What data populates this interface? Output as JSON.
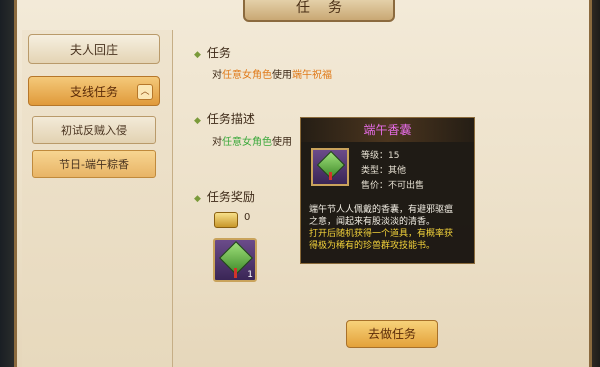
{
  "window": {
    "title": "任务"
  },
  "sidebar": {
    "tabs": [
      {
        "label": "夫人回庄"
      },
      {
        "label": "支线任务",
        "toggle": "︿"
      }
    ],
    "sub_items": [
      {
        "label": "初试反贼入侵"
      },
      {
        "label": "节日-端午粽香"
      }
    ]
  },
  "task": {
    "heading": "任务",
    "line": {
      "prefix": "对",
      "target": "任意女角色",
      "verb": "使用",
      "item": "端午祝福"
    }
  },
  "description": {
    "heading": "任务描述",
    "line": {
      "prefix": "对",
      "target": "任意女角色",
      "verb": "使用"
    }
  },
  "rewards": {
    "heading": "任务奖励",
    "coin_value": "0",
    "item_qty": "1"
  },
  "do_task_button": "去做任务",
  "tooltip": {
    "name": "端午香囊",
    "level_label": "等级：",
    "level_value": "15",
    "type_label": "类型：",
    "type_value": "其他",
    "price_label": "售价：",
    "price_value": "不可出售",
    "desc_line1": "端午节人人佩戴的香囊，有避邪驱瘟",
    "desc_line2": "之意，闻起来有股淡淡的清香。",
    "effect_line1": "打开后随机获得一个道具，有概率获",
    "effect_line2": "得极为稀有的珍兽群攻技能书。"
  }
}
